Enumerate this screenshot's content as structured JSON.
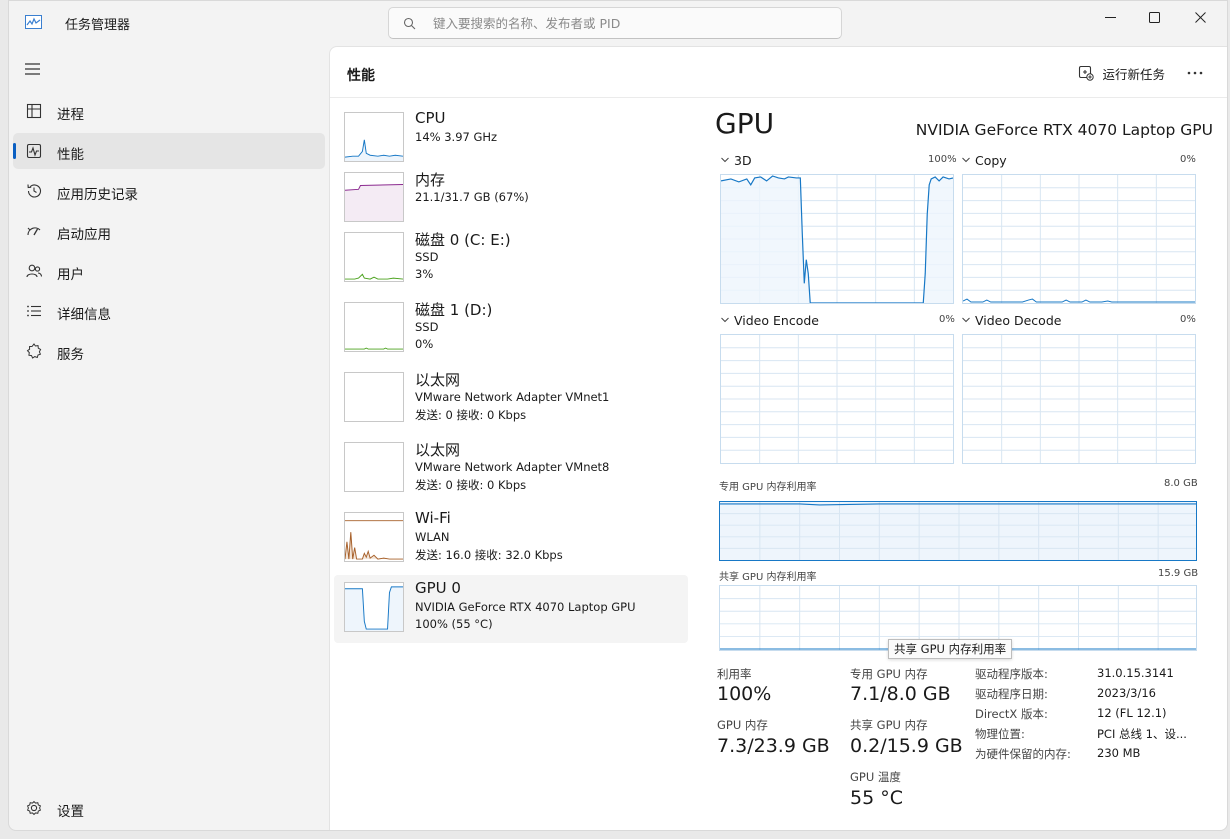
{
  "window": {
    "title": "任务管理器",
    "search_placeholder": "键入要搜索的名称、发布者或 PID"
  },
  "sidebar": {
    "items": [
      {
        "label": "进程",
        "icon": "processes-icon"
      },
      {
        "label": "性能",
        "icon": "performance-icon",
        "active": true
      },
      {
        "label": "应用历史记录",
        "icon": "app-history-icon"
      },
      {
        "label": "启动应用",
        "icon": "startup-icon"
      },
      {
        "label": "用户",
        "icon": "users-icon"
      },
      {
        "label": "详细信息",
        "icon": "details-icon"
      },
      {
        "label": "服务",
        "icon": "services-icon"
      }
    ],
    "settings_label": "设置"
  },
  "header": {
    "title": "性能",
    "run_task": "运行新任务"
  },
  "devices": [
    {
      "name": "CPU",
      "line1": "14% 3.97 GHz",
      "line2": "",
      "color": "#1778c6"
    },
    {
      "name": "内存",
      "line1": "21.1/31.7 GB (67%)",
      "line2": "",
      "color": "#8b2a8f"
    },
    {
      "name": "磁盘 0 (C: E:)",
      "line1": "SSD",
      "line2": "3%",
      "color": "#4ba21e"
    },
    {
      "name": "磁盘 1 (D:)",
      "line1": "SSD",
      "line2": "0%",
      "color": "#4ba21e"
    },
    {
      "name": "以太网",
      "line1": "VMware Network Adapter VMnet1",
      "line2": "发送: 0 接收: 0 Kbps",
      "color": "#a7602a"
    },
    {
      "name": "以太网",
      "line1": "VMware Network Adapter VMnet8",
      "line2": "发送: 0 接收: 0 Kbps",
      "color": "#a7602a"
    },
    {
      "name": "Wi-Fi",
      "line1": "WLAN",
      "line2": "发送: 16.0 接收: 32.0 Kbps",
      "color": "#a7602a"
    },
    {
      "name": "GPU 0",
      "line1": "NVIDIA GeForce RTX 4070 Laptop GPU",
      "line2": "100% (55 °C)",
      "color": "#1778c6",
      "active": true
    }
  ],
  "gpu": {
    "title": "GPU",
    "model": "NVIDIA GeForce RTX 4070 Laptop GPU",
    "engines": [
      {
        "name": "3D",
        "pct": "100%"
      },
      {
        "name": "Copy",
        "pct": "0%"
      },
      {
        "name": "Video Encode",
        "pct": "0%"
      },
      {
        "name": "Video Decode",
        "pct": "0%"
      }
    ],
    "dedicated_label": "专用 GPU 内存利用率",
    "dedicated_max": "8.0 GB",
    "shared_label": "共享 GPU 内存利用率",
    "shared_max": "15.9 GB",
    "tooltip": "共享 GPU 内存利用率",
    "stats": {
      "util_label": "利用率",
      "util_value": "100%",
      "ded_label": "专用 GPU 内存",
      "ded_value": "7.1/8.0 GB",
      "gpumem_label": "GPU 内存",
      "gpumem_value": "7.3/23.9 GB",
      "shared_label": "共享 GPU 内存",
      "shared_value": "0.2/15.9 GB",
      "temp_label": "GPU 温度",
      "temp_value": "55 °C"
    },
    "info": [
      {
        "k": "驱动程序版本:",
        "v": "31.0.15.3141"
      },
      {
        "k": "驱动程序日期:",
        "v": "2023/3/16"
      },
      {
        "k": "DirectX 版本:",
        "v": "12 (FL 12.1)"
      },
      {
        "k": "物理位置:",
        "v": "PCI 总线 1、设..."
      },
      {
        "k": "为硬件保留的内存:",
        "v": "230 MB"
      }
    ]
  },
  "colors": {
    "accent": "#0a5fc2",
    "gpu_line": "#1778c6",
    "grid": "#d8e6f2"
  }
}
